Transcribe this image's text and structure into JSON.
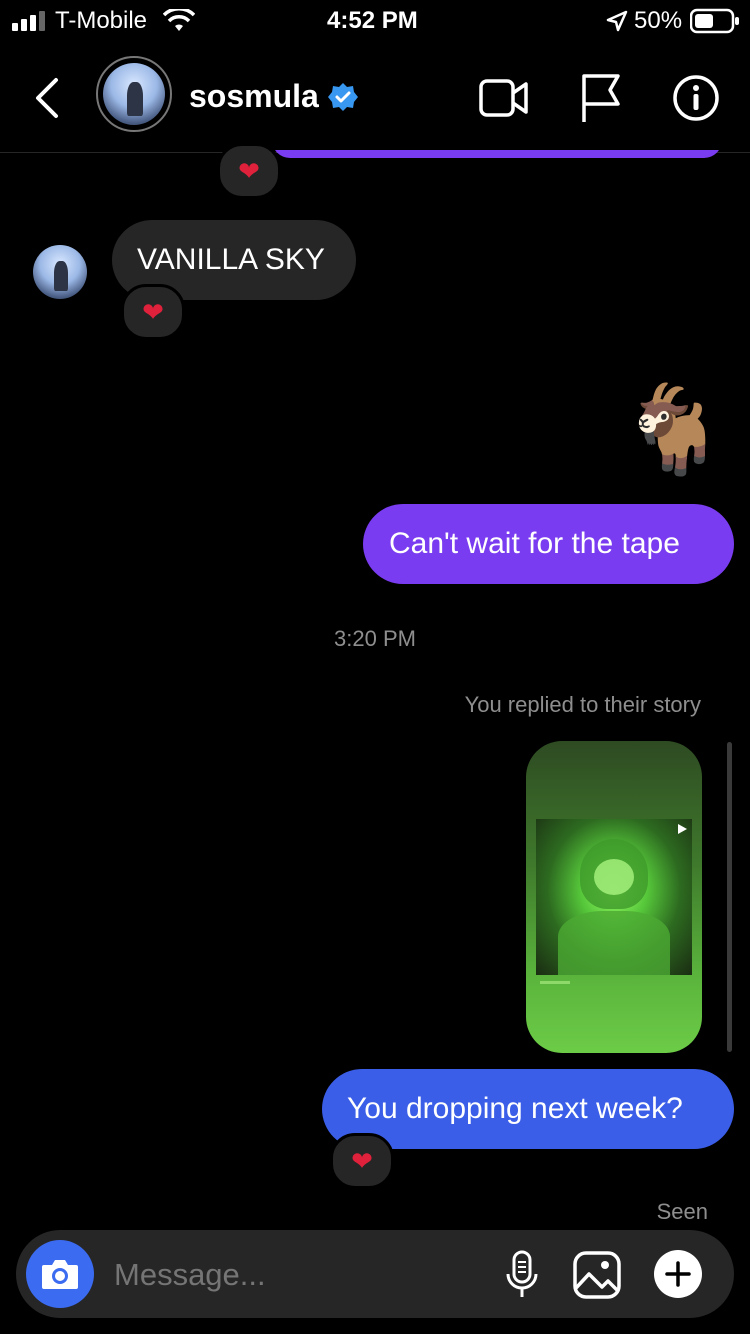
{
  "status_bar": {
    "carrier": "T-Mobile",
    "time": "4:52 PM",
    "battery": "50%"
  },
  "header": {
    "username": "sosmula",
    "verified": true,
    "icons": [
      "back-chevron-icon",
      "video-call-icon",
      "flag-icon",
      "info-icon"
    ]
  },
  "messages": {
    "received_1": "VANILLA SKY",
    "sent_emoji": "🐐",
    "sent_1": "Can't wait for the tape",
    "timestamp": "3:20 PM",
    "story_reply_note": "You replied to their story",
    "sent_2": "You dropping next week?",
    "seen": "Seen",
    "reaction": "❤"
  },
  "composer": {
    "placeholder": "Message..."
  },
  "colors": {
    "sent_purple": "#7a3cf0",
    "sent_blue": "#3b5ee8",
    "received_bg": "#262626",
    "verified_blue": "#3897f0",
    "camera_blue": "#3b6bf0"
  }
}
